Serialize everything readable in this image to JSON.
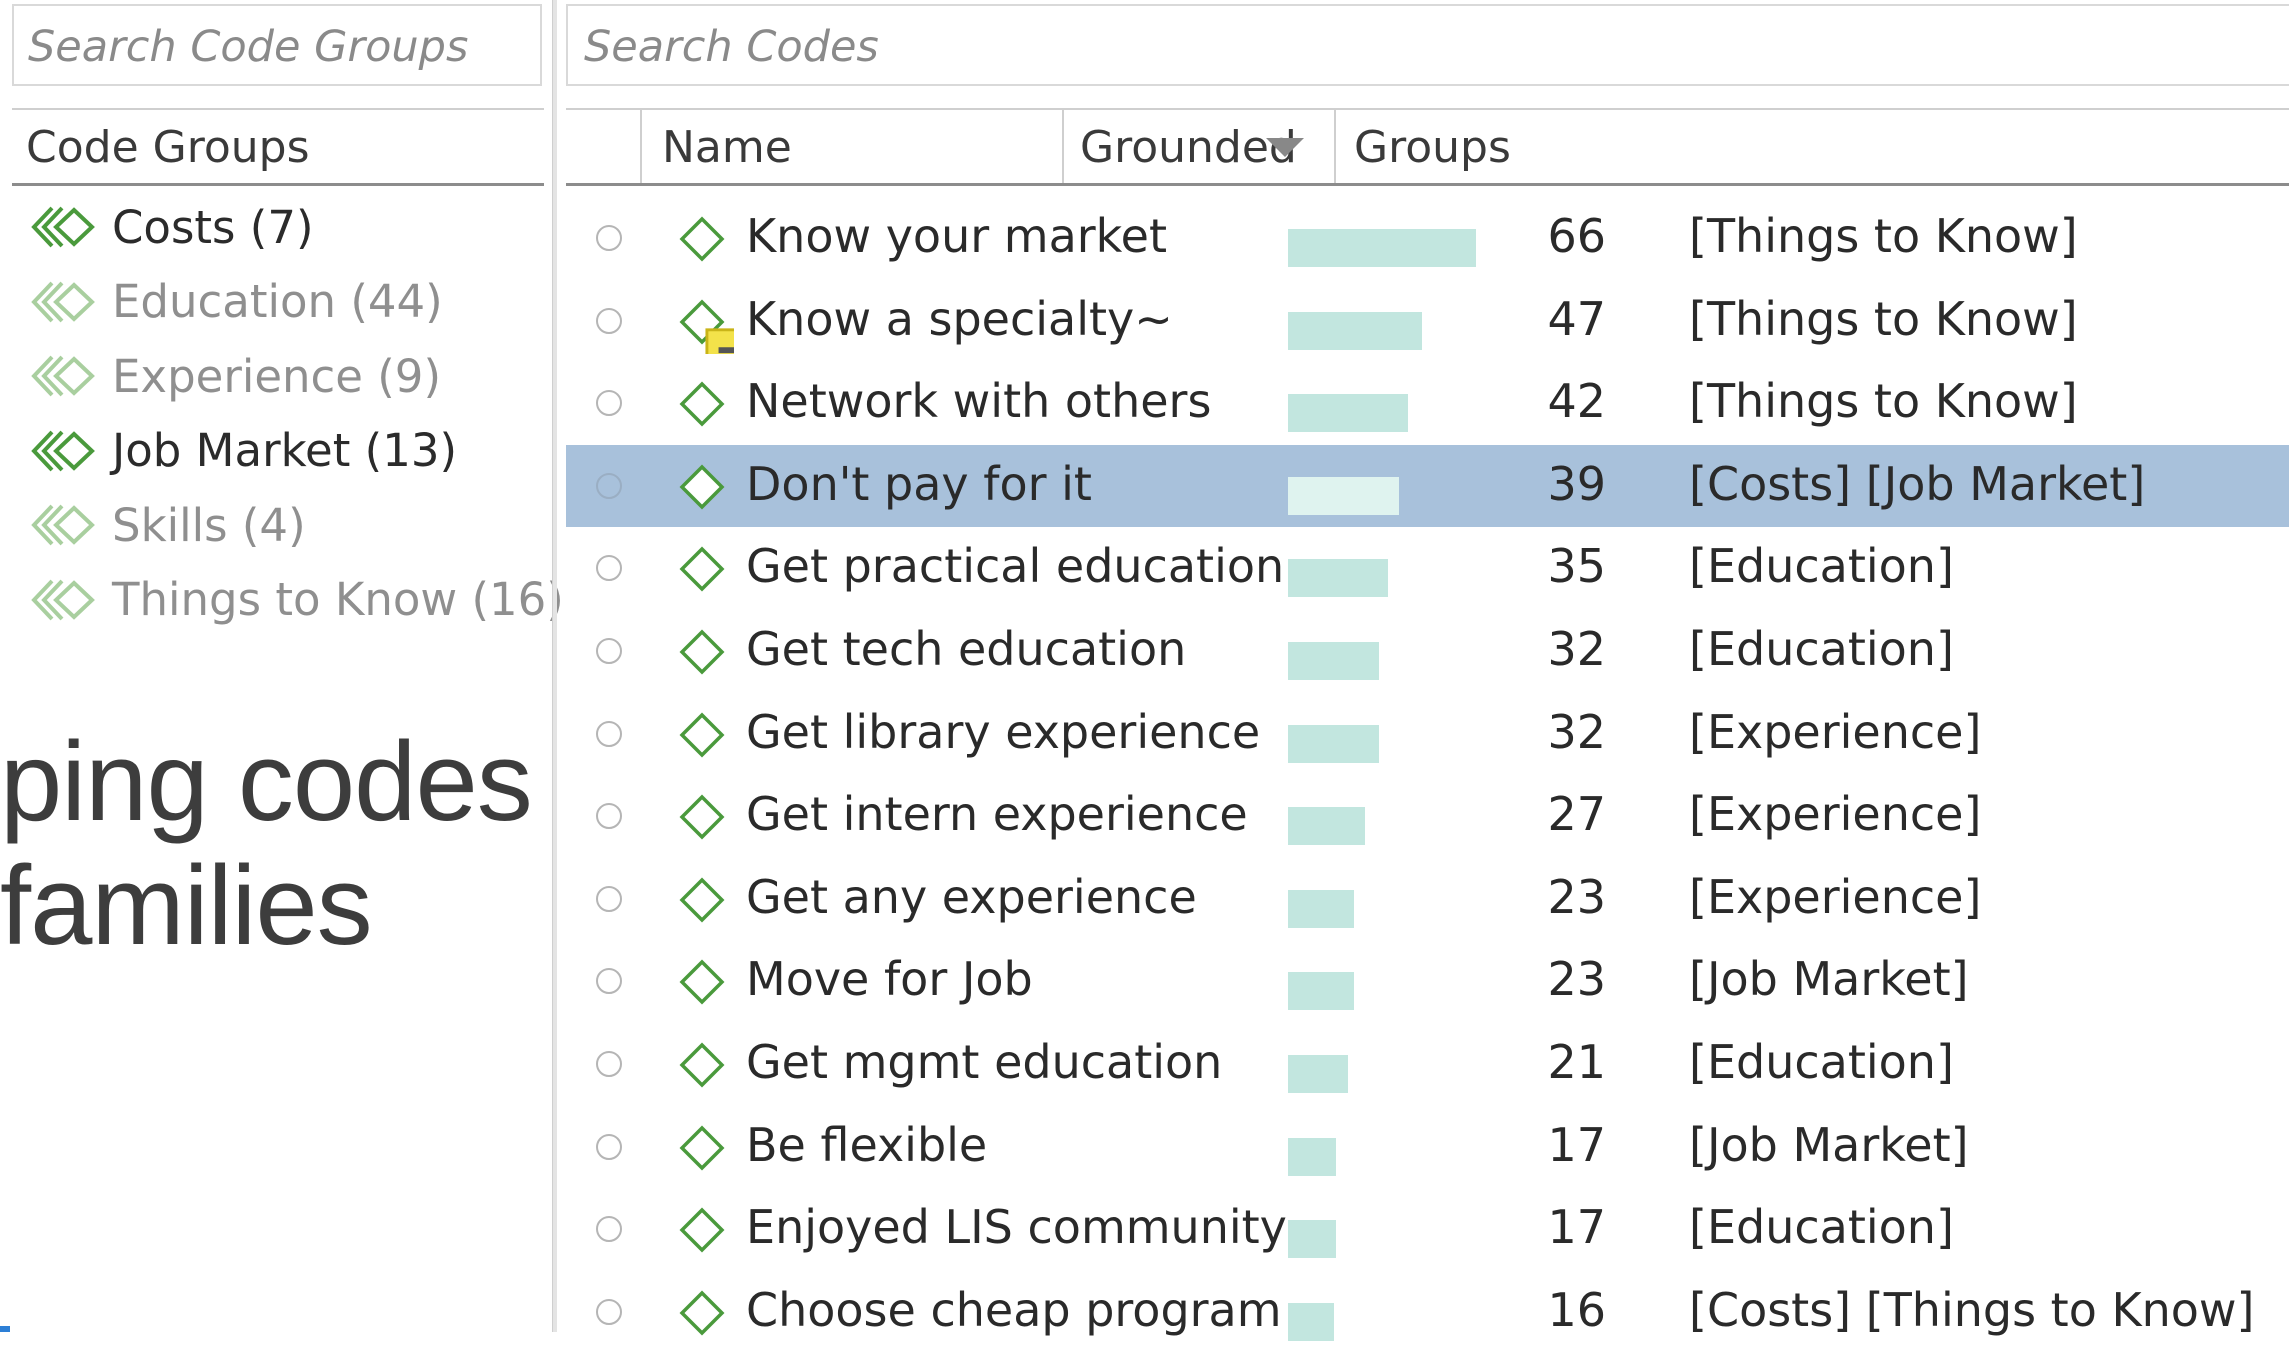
{
  "left_panel": {
    "search_placeholder": "Search Code Groups",
    "header": "Code Groups",
    "groups": [
      {
        "label": "Costs (7)",
        "active": true
      },
      {
        "label": "Education (44)",
        "active": false
      },
      {
        "label": "Experience (9)",
        "active": false
      },
      {
        "label": "Job Market (13)",
        "active": true
      },
      {
        "label": "Skills (4)",
        "active": false
      },
      {
        "label": "Things to Know (16)",
        "active": false
      }
    ]
  },
  "overlay_text": {
    "line1": "ping codes",
    "line2": "families"
  },
  "codes_panel": {
    "search_placeholder": "Search Codes",
    "columns": {
      "name": "Name",
      "grounded": "Grounded",
      "groups": "Groups"
    },
    "rows": [
      {
        "name": "Know your market",
        "grounded": 66,
        "groups": "[Things to Know]",
        "selected": false,
        "has_memo": false
      },
      {
        "name": "Know a specialty~",
        "grounded": 47,
        "groups": "[Things to Know]",
        "selected": false,
        "has_memo": true
      },
      {
        "name": "Network with others",
        "grounded": 42,
        "groups": "[Things to Know]",
        "selected": false,
        "has_memo": false
      },
      {
        "name": "Don't pay for it",
        "grounded": 39,
        "groups": "[Costs] [Job Market]",
        "selected": true,
        "has_memo": false
      },
      {
        "name": "Get practical education",
        "grounded": 35,
        "groups": "[Education]",
        "selected": false,
        "has_memo": false
      },
      {
        "name": "Get tech education",
        "grounded": 32,
        "groups": "[Education]",
        "selected": false,
        "has_memo": false
      },
      {
        "name": "Get library experience",
        "grounded": 32,
        "groups": "[Experience]",
        "selected": false,
        "has_memo": false
      },
      {
        "name": "Get intern experience",
        "grounded": 27,
        "groups": "[Experience]",
        "selected": false,
        "has_memo": false
      },
      {
        "name": "Get any experience",
        "grounded": 23,
        "groups": "[Experience]",
        "selected": false,
        "has_memo": false
      },
      {
        "name": "Move for Job",
        "grounded": 23,
        "groups": "[Job Market]",
        "selected": false,
        "has_memo": false
      },
      {
        "name": "Get mgmt education",
        "grounded": 21,
        "groups": "[Education]",
        "selected": false,
        "has_memo": false
      },
      {
        "name": "Be flexible",
        "grounded": 17,
        "groups": "[Job Market]",
        "selected": false,
        "has_memo": false
      },
      {
        "name": "Enjoyed LIS community",
        "grounded": 17,
        "groups": "[Education]",
        "selected": false,
        "has_memo": false
      },
      {
        "name": "Choose cheap program",
        "grounded": 16,
        "groups": "[Costs] [Things to Know]",
        "selected": false,
        "has_memo": false
      }
    ]
  },
  "colors": {
    "bar": "#c2e6df",
    "selected_row": "#a8c1db",
    "code_icon": "#4a9a3c"
  }
}
